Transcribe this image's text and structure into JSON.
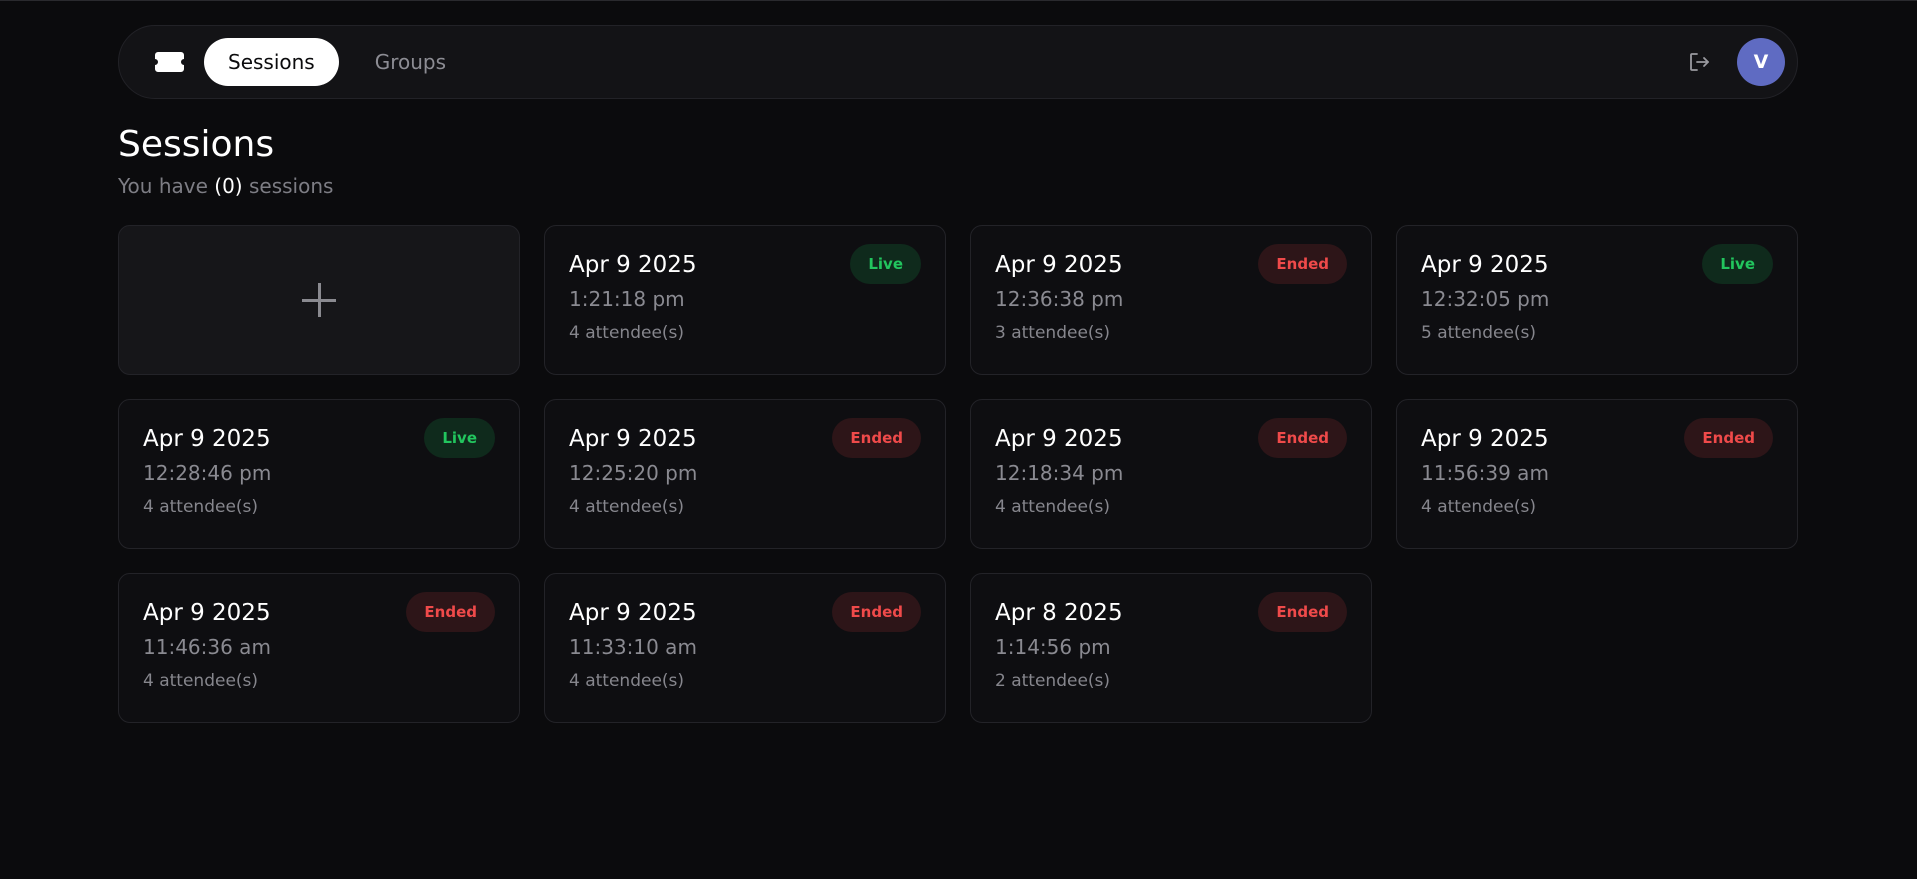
{
  "nav": {
    "logo_icon": "ticket-icon",
    "tabs": [
      {
        "label": "Sessions",
        "active": true
      },
      {
        "label": "Groups",
        "active": false
      }
    ],
    "logout_icon": "logout-icon",
    "avatar_initial": "V",
    "avatar_color": "#5f6bc2"
  },
  "header": {
    "title": "Sessions",
    "subtitle_prefix": "You have ",
    "subtitle_count": "(0)",
    "subtitle_suffix": " sessions"
  },
  "new_session_icon": "plus-icon",
  "colors": {
    "live_text": "#22c55e",
    "live_bg": "#0f2a1c",
    "ended_text": "#ef4a4a",
    "ended_bg": "#2d1518"
  },
  "sessions": [
    {
      "date": "Apr 9 2025",
      "time": "1:21:18 pm",
      "attendees": "4 attendee(s)",
      "status": "Live"
    },
    {
      "date": "Apr 9 2025",
      "time": "12:36:38 pm",
      "attendees": "3 attendee(s)",
      "status": "Ended"
    },
    {
      "date": "Apr 9 2025",
      "time": "12:32:05 pm",
      "attendees": "5 attendee(s)",
      "status": "Live"
    },
    {
      "date": "Apr 9 2025",
      "time": "12:28:46 pm",
      "attendees": "4 attendee(s)",
      "status": "Live"
    },
    {
      "date": "Apr 9 2025",
      "time": "12:25:20 pm",
      "attendees": "4 attendee(s)",
      "status": "Ended"
    },
    {
      "date": "Apr 9 2025",
      "time": "12:18:34 pm",
      "attendees": "4 attendee(s)",
      "status": "Ended"
    },
    {
      "date": "Apr 9 2025",
      "time": "11:56:39 am",
      "attendees": "4 attendee(s)",
      "status": "Ended"
    },
    {
      "date": "Apr 9 2025",
      "time": "11:46:36 am",
      "attendees": "4 attendee(s)",
      "status": "Ended"
    },
    {
      "date": "Apr 9 2025",
      "time": "11:33:10 am",
      "attendees": "4 attendee(s)",
      "status": "Ended"
    },
    {
      "date": "Apr 8 2025",
      "time": "1:14:56 pm",
      "attendees": "2 attendee(s)",
      "status": "Ended"
    }
  ]
}
